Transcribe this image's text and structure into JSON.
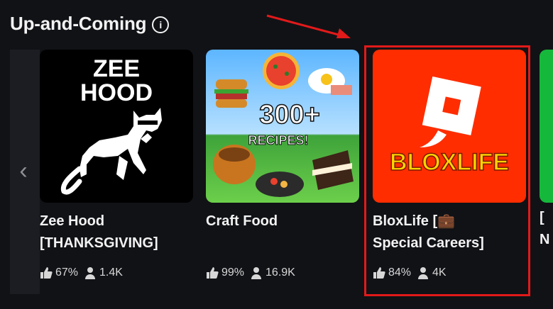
{
  "section": {
    "title": "Up-and-Coming",
    "info_icon": "info-icon",
    "left_arrow_icon": "chevron-left-icon"
  },
  "cards": [
    {
      "name": "Zee Hood",
      "title_line1": "Zee Hood",
      "title_line2": "[THANKSGIVING]",
      "thumb_text_line1": "ZEE",
      "thumb_text_line2": "HOOD",
      "like_pct": "67%",
      "players": "1.4K"
    },
    {
      "name": "Craft Food",
      "title_line1": "Craft Food",
      "title_line2": "",
      "thumb_text_line1": "300+",
      "thumb_text_line2": "RECIPES!",
      "like_pct": "99%",
      "players": "16.9K"
    },
    {
      "name": "BloxLife",
      "title_line1": "BloxLife [💼",
      "title_line2": "Special Careers]",
      "thumb_text_line1": "BLOXLIFE",
      "like_pct": "84%",
      "players": "4K"
    }
  ],
  "next_card": {
    "title_line1": "[",
    "title_line2": "N"
  },
  "colors": {
    "background": "#111216",
    "highlight": "#e11a1a",
    "bloxlife_bg": "#ff2d00",
    "bloxlife_text": "#ffd400"
  }
}
